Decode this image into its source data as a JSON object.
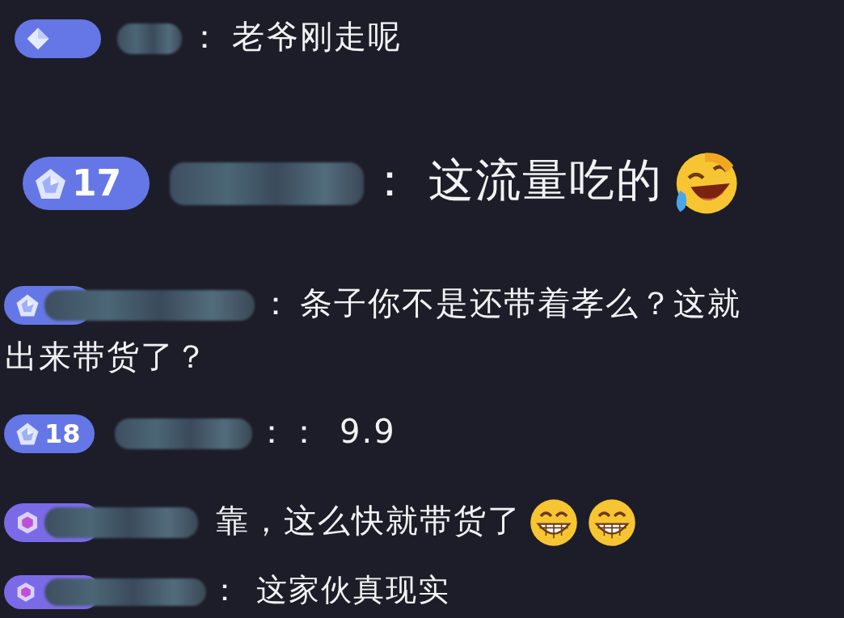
{
  "messages": [
    {
      "badge": {
        "kind": "diamond",
        "color": "#6577e6"
      },
      "separator": "：",
      "text": "老爷刚走呢"
    },
    {
      "badge": {
        "kind": "pentagon",
        "color": "#6577e6",
        "level": "17"
      },
      "separator": "：",
      "text": "这流量吃的",
      "emojis": [
        {
          "kind": "rofl"
        }
      ]
    },
    {
      "badge": {
        "kind": "pentagon",
        "color": "#6577e6"
      },
      "separator": "：",
      "text": "条子你不是还带着孝么？这就",
      "continuation": "出来带货了？"
    },
    {
      "badge": {
        "kind": "pentagon",
        "color": "#6577e6",
        "level": "18"
      },
      "separator": "：：",
      "text": "9.9"
    },
    {
      "badge": {
        "kind": "gem",
        "color": "#7b6ae8"
      },
      "text": "靠，这么快就带货了",
      "emojis": [
        {
          "kind": "grin"
        },
        {
          "kind": "grin"
        }
      ]
    },
    {
      "badge": {
        "kind": "gem",
        "color": "#7b6ae8"
      },
      "separator": "：",
      "text": "这家伙真现实"
    }
  ]
}
